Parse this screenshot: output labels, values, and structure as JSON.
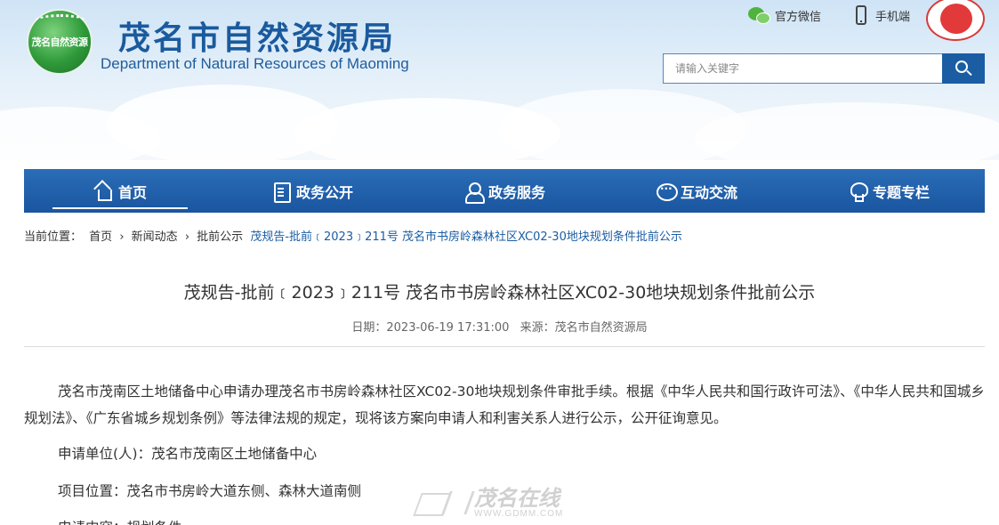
{
  "header": {
    "logo_text": "茂名自然资源",
    "title": "茂名市自然资源局",
    "subtitle": "Department of Natural Resources of Maoming",
    "links": [
      {
        "label": "官方微信",
        "icon": "wechat-icon"
      },
      {
        "label": "手机端",
        "icon": "mobile-phone-icon"
      }
    ],
    "emblem_icon": "city-emblem-icon",
    "search": {
      "placeholder": "请输入关键字",
      "icon": "search-icon"
    }
  },
  "nav": {
    "items": [
      {
        "label": "首页",
        "icon": "home-icon",
        "active": true
      },
      {
        "label": "政务公开",
        "icon": "document-icon"
      },
      {
        "label": "政务服务",
        "icon": "service-user-icon"
      },
      {
        "label": "互动交流",
        "icon": "chat-bubble-icon"
      },
      {
        "label": "专题专栏",
        "icon": "topic-lamp-icon"
      }
    ]
  },
  "breadcrumb": {
    "prefix": "当前位置：",
    "items": [
      "首页",
      "新闻动态",
      "批前公示"
    ],
    "separator": "›",
    "current": "茂规告-批前﹝2023﹞211号 茂名市书房岭森林社区XC02-30地块规划条件批前公示"
  },
  "article": {
    "title": "茂规告-批前﹝2023﹞211号 茂名市书房岭森林社区XC02-30地块规划条件批前公示",
    "date_label": "日期：2023-06-19 17:31:00",
    "source_label": "来源：茂名市自然资源局",
    "paragraphs": [
      "茂名市茂南区土地储备中心申请办理茂名市书房岭森林社区XC02-30地块规划条件审批手续。根据《中华人民共和国行政许可法》、《中华人民共和国城乡规划法》、《广东省城乡规划条例》等法律法规的规定，现将该方案向申请人和利害关系人进行公示，公开征询意见。",
      "申请单位(人)：茂名市茂南区土地储备中心",
      "项目位置：茂名市书房岭大道东侧、森林大道南侧",
      "申请内容：规划条件"
    ]
  },
  "watermark": {
    "text": "茂名在线",
    "url": "WWW.GDMM.COM"
  },
  "colors": {
    "primary": "#1b5da3",
    "nav_bg": "#1f5ea8",
    "title_blue": "#1a5a9e"
  }
}
